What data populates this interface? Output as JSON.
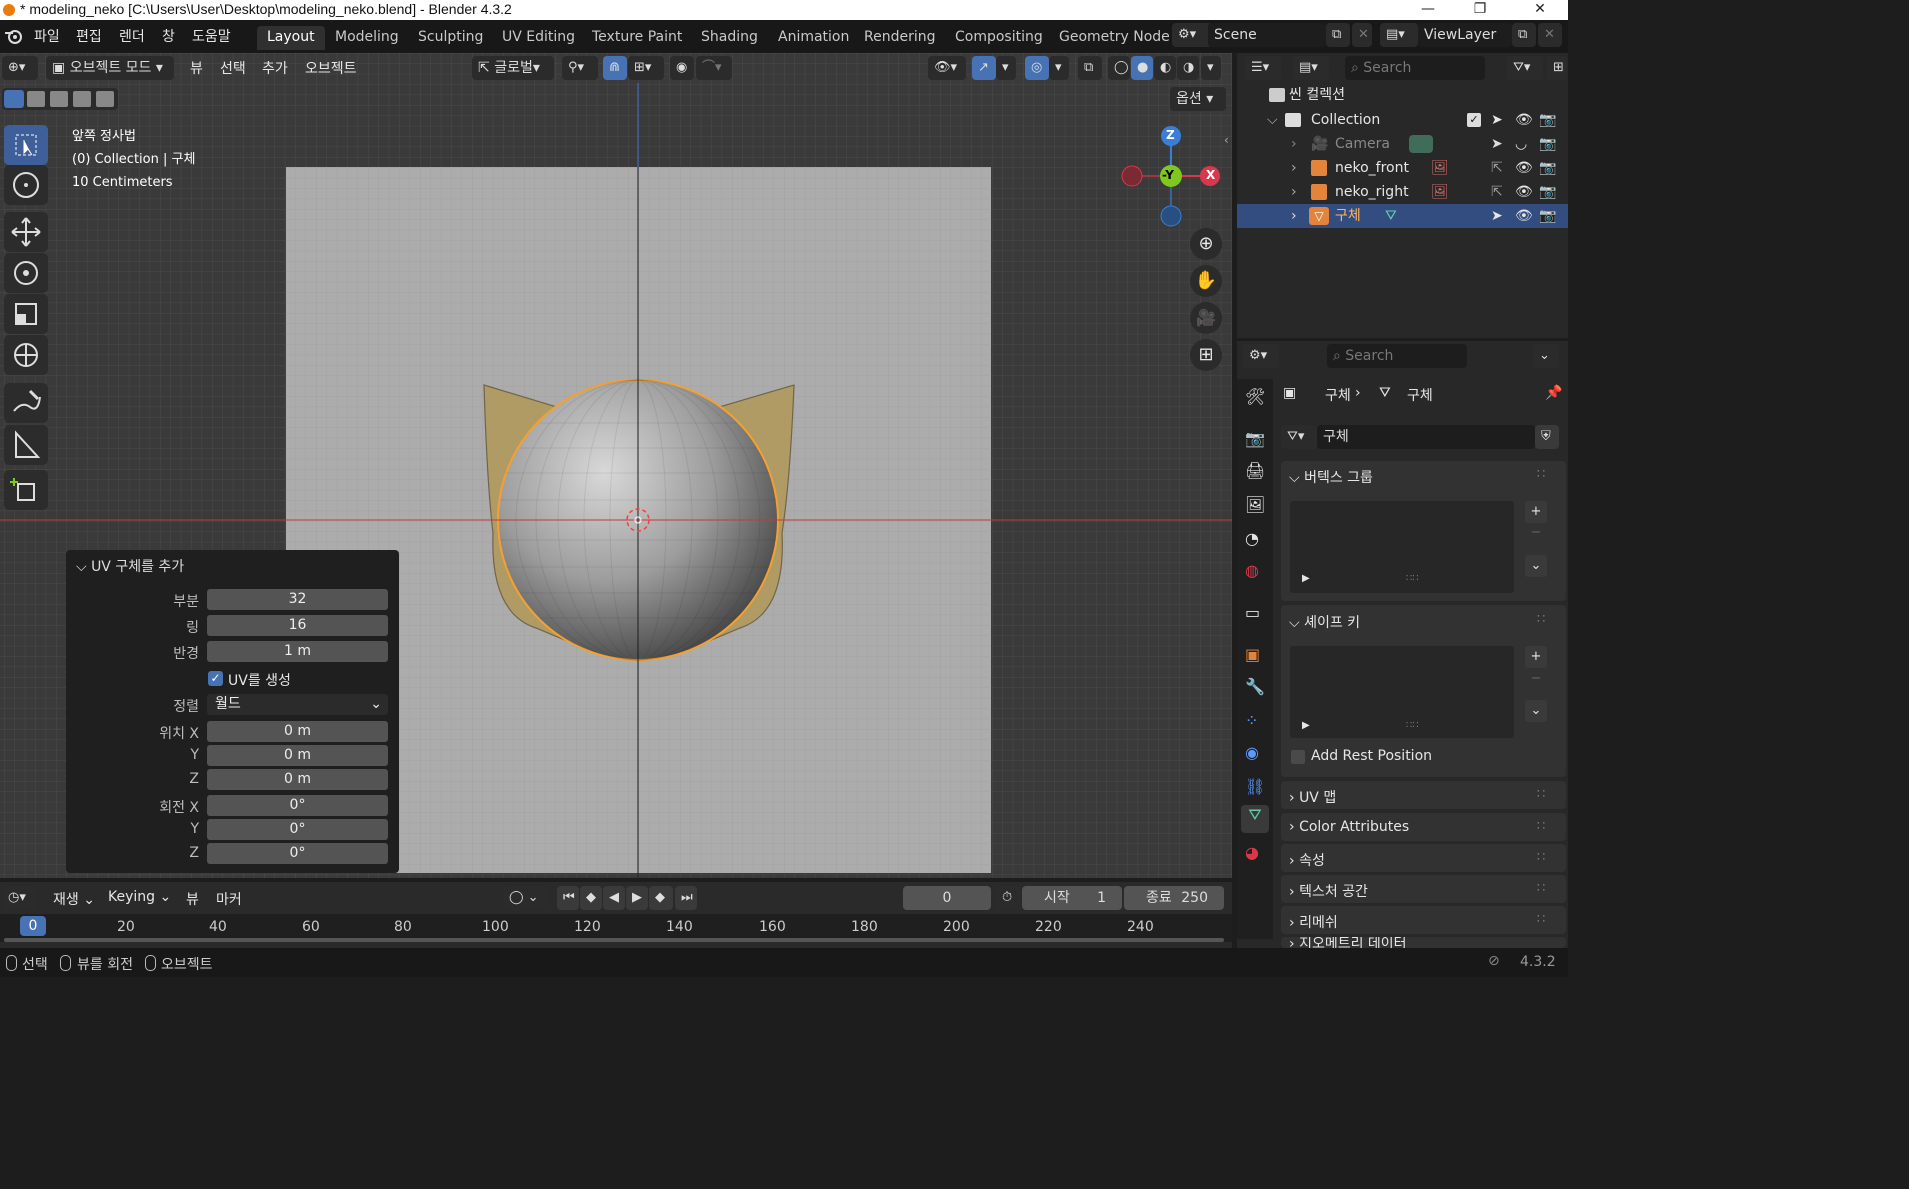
{
  "window": {
    "title": "* modeling_neko [C:\\Users\\User\\Desktop\\modeling_neko.blend] - Blender 4.3.2"
  },
  "menu": [
    "파일",
    "편집",
    "렌더",
    "창",
    "도움말"
  ],
  "workspaces": [
    "Layout",
    "Modeling",
    "Sculpting",
    "UV Editing",
    "Texture Paint",
    "Shading",
    "Animation",
    "Rendering",
    "Compositing",
    "Geometry Node"
  ],
  "scene": {
    "label": "Scene"
  },
  "viewlayer": {
    "label": "ViewLayer"
  },
  "viewport_header": {
    "mode": "오브젝트 모드",
    "menus": [
      "뷰",
      "선택",
      "추가",
      "오브젝트"
    ],
    "transform_orientation": "글로벌",
    "options": "옵션"
  },
  "viewport_info": {
    "view_name": "앞쪽 정사법",
    "collection": "(0) Collection | 구체",
    "scale": "10 Centimeters"
  },
  "gizmo": {
    "z": "Z",
    "y": "-Y",
    "x": "X"
  },
  "operator_panel": {
    "title": "UV 구체를 추가",
    "fields": [
      {
        "label": "부분",
        "value": "32"
      },
      {
        "label": "링",
        "value": "16"
      },
      {
        "label": "반경",
        "value": "1 m"
      }
    ],
    "uv_checkbox": "UV를 생성",
    "align_label": "정렬",
    "align_value": "월드",
    "location": [
      {
        "label": "위치 X",
        "value": "0 m"
      },
      {
        "label": "Y",
        "value": "0 m"
      },
      {
        "label": "Z",
        "value": "0 m"
      }
    ],
    "rotation": [
      {
        "label": "회전 X",
        "value": "0°"
      },
      {
        "label": "Y",
        "value": "0°"
      },
      {
        "label": "Z",
        "value": "0°"
      }
    ]
  },
  "outliner": {
    "search_placeholder": "Search",
    "scene_collection": "씬 컬렉션",
    "collection": "Collection",
    "items": [
      "Camera",
      "neko_front",
      "neko_right",
      "구체"
    ]
  },
  "properties": {
    "search_placeholder": "Search",
    "breadcrumb_object": "구체",
    "breadcrumb_mesh": "구체",
    "mesh_name": "구체",
    "panels": {
      "vertex_groups": "버텍스 그룹",
      "shape_keys": "셰이프 키",
      "add_rest_position": "Add Rest Position",
      "uv_maps": "UV 맵",
      "color_attributes": "Color Attributes",
      "attributes": "속성",
      "texture_space": "텍스처 공간",
      "remesh": "리메쉬",
      "geometry_data": "지오메트리 데이터"
    }
  },
  "timeline": {
    "menus": [
      "재생",
      "Keying",
      "뷰",
      "마커"
    ],
    "current_frame": "0",
    "start_label": "시작",
    "start": "1",
    "end_label": "종료",
    "end": "250",
    "ticks": [
      "0",
      "20",
      "40",
      "60",
      "80",
      "100",
      "120",
      "140",
      "160",
      "180",
      "200",
      "220",
      "240"
    ]
  },
  "statusbar": {
    "select": "선택",
    "rotate_view": "뷰를 회전",
    "object": "오브젝트",
    "version": "4.3.2"
  },
  "colors": {
    "accent": "#4772b3",
    "selected_orange": "#f5a030",
    "x_axis": "#d9384b",
    "y_axis": "#7ec81f",
    "z_axis": "#3a7ed6"
  }
}
